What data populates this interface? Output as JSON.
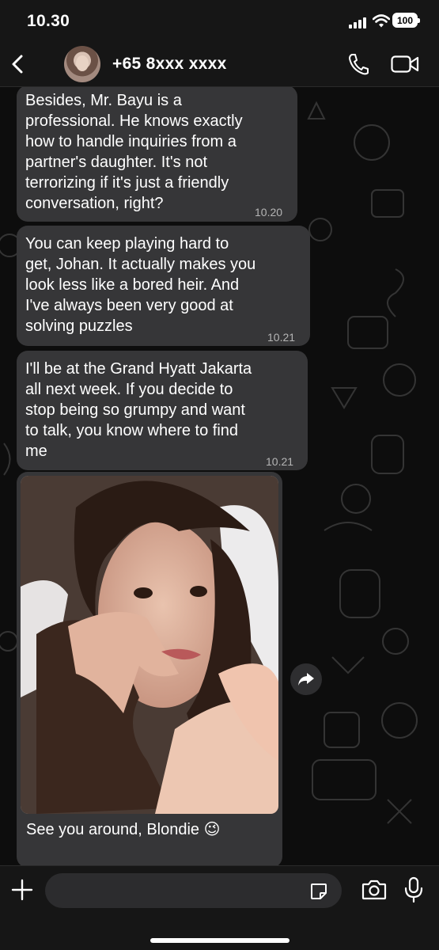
{
  "status_bar": {
    "time": "10.30",
    "battery": "100"
  },
  "header": {
    "back_icon": "chevron-left-icon",
    "contact_name": "+65 8xxx xxxx",
    "call_icon": "phone-icon",
    "video_icon": "video-camera-icon"
  },
  "messages": [
    {
      "text": "Besides, Mr. Bayu is a\nprofessional. He knows exactly\nhow to handle inquiries from a\npartner's daughter. It's not\nterrorizing if it's just a friendly\nconversation, right?",
      "time": "10.20"
    },
    {
      "text": "You can keep playing hard to\nget, Johan. It actually makes you\nlook less like a bored heir. And\nI've always been very good at\nsolving puzzles",
      "time": "10.21"
    },
    {
      "text": "I'll be at the Grand Hyatt Jakarta\nall next week. If you decide to\nstop being so grumpy and want\nto talk, you know where to find\nme",
      "time": "10.21"
    },
    {
      "type": "photo",
      "caption": "See you around, Blondie 😉"
    }
  ],
  "forward_icon": "forward-arrow-icon",
  "input_bar": {
    "placeholder": "",
    "plus_icon": "plus-icon",
    "sticker_icon": "sticker-icon",
    "camera_icon": "camera-icon",
    "mic_icon": "microphone-icon"
  },
  "colors": {
    "bubble": "#363638",
    "background": "#0d0d0d",
    "bar": "#161616"
  }
}
